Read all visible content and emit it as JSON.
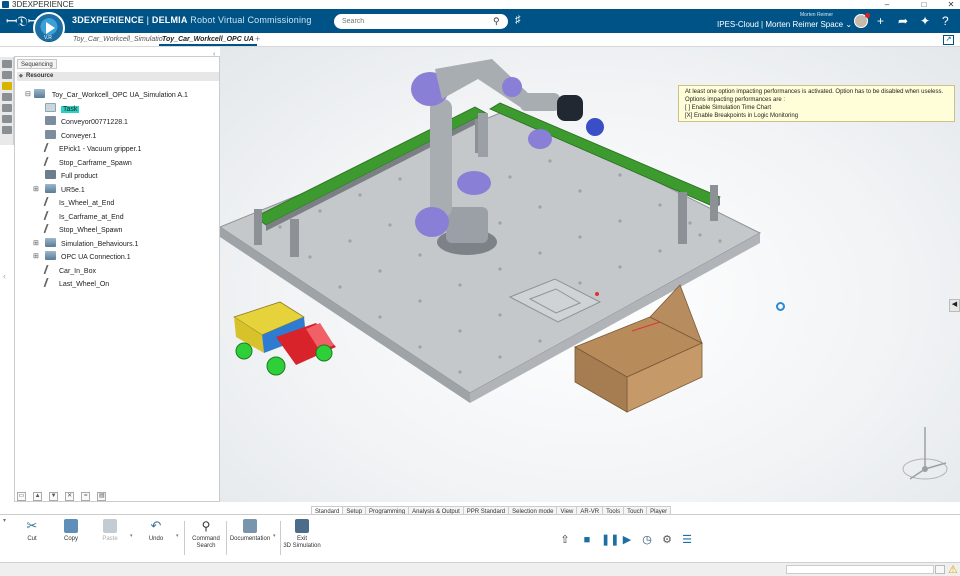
{
  "window": {
    "title": "3DEXPERIENCE",
    "controls": [
      "–",
      "□",
      "✕"
    ]
  },
  "header": {
    "brand_bold": "3DEXPERIENCE",
    "brand_sep": " | ",
    "brand_product": "DELMIA",
    "brand_app": " Robot Virtual Commissioning",
    "compass_version": "V.R",
    "search_placeholder": "Search",
    "user_name": "Morten Reimer",
    "space": "IPES-Cloud | Morten Reimer Space",
    "space_chevron": "⌄"
  },
  "tabs": [
    {
      "label": "Toy_Car_Workcell_Simulatio",
      "active": false
    },
    {
      "label": "Toy_Car_Workcell_OPC UA",
      "active": true
    }
  ],
  "add_tab": "+",
  "tree": {
    "panel_tab": "Sequencing",
    "section_header": "Resource",
    "root": "Toy_Car_Workcell_OPC UA_Simulation A.1",
    "items": [
      {
        "label": "Task",
        "icon": "task-icon",
        "selected": true,
        "expandable": false
      },
      {
        "label": "Conveyor00771228.1",
        "icon": "conveyor-icon",
        "selected": false,
        "expandable": false
      },
      {
        "label": "Conveyer.1",
        "icon": "conveyor-icon",
        "selected": false,
        "expandable": false
      },
      {
        "label": "EPick1 - Vacuum gripper.1",
        "icon": "gripper-icon",
        "selected": false,
        "expandable": false
      },
      {
        "label": "Stop_Carframe_Spawn",
        "icon": "sensor-icon",
        "selected": false,
        "expandable": false
      },
      {
        "label": "Full product",
        "icon": "product-icon",
        "selected": false,
        "expandable": false
      },
      {
        "label": "UR5e.1",
        "icon": "robot-icon",
        "selected": false,
        "expandable": true
      },
      {
        "label": "Is_Wheel_at_End",
        "icon": "sensor-icon",
        "selected": false,
        "expandable": false
      },
      {
        "label": "Is_Carframe_at_End",
        "icon": "sensor-icon",
        "selected": false,
        "expandable": false
      },
      {
        "label": "Stop_Wheel_Spawn",
        "icon": "sensor-icon",
        "selected": false,
        "expandable": false
      },
      {
        "label": "Simulation_Behaviours.1",
        "icon": "behaviour-icon",
        "selected": false,
        "expandable": true
      },
      {
        "label": "OPC UA Connection.1",
        "icon": "opcua-icon",
        "selected": false,
        "expandable": true
      },
      {
        "label": "Car_In_Box",
        "icon": "sensor-icon",
        "selected": false,
        "expandable": false
      },
      {
        "label": "Last_Wheel_On",
        "icon": "sensor-icon",
        "selected": false,
        "expandable": false
      }
    ],
    "bottom_buttons": [
      "▭",
      "▲",
      "▼",
      "✕",
      "=",
      "▤"
    ]
  },
  "notification": {
    "lines": [
      "At least one option impacting performances is activated. Option has to be disabled when useless.",
      "Options impacting performances are :",
      "[ ] Enable Simulation Time Chart",
      "[X] Enable Breakpoints in Logic Monitoring"
    ]
  },
  "action_tabs": [
    {
      "label": "Standard",
      "active": true
    },
    {
      "label": "Setup",
      "active": false
    },
    {
      "label": "Programming",
      "active": false
    },
    {
      "label": "Analysis & Output",
      "active": false
    },
    {
      "label": "PPR Standard",
      "active": false
    },
    {
      "label": "Selection mode",
      "active": false
    },
    {
      "label": "View",
      "active": false
    },
    {
      "label": "AR-VR",
      "active": false
    },
    {
      "label": "Tools",
      "active": false
    },
    {
      "label": "Touch",
      "active": false
    },
    {
      "label": "Player",
      "active": false
    }
  ],
  "commands": {
    "cut": "Cut",
    "copy": "Copy",
    "paste": "Paste",
    "undo": "Undo",
    "command_search_1": "Command",
    "command_search_2": "Search",
    "documentation": "Documentation",
    "exit_1": "Exit",
    "exit_2": "3D Simulation"
  },
  "colors": {
    "header_blue": "#005386",
    "selection_teal": "#2bd1c3",
    "conveyor_green": "#3c9a2e",
    "robot_joint_purple": "#8a7fd6"
  }
}
